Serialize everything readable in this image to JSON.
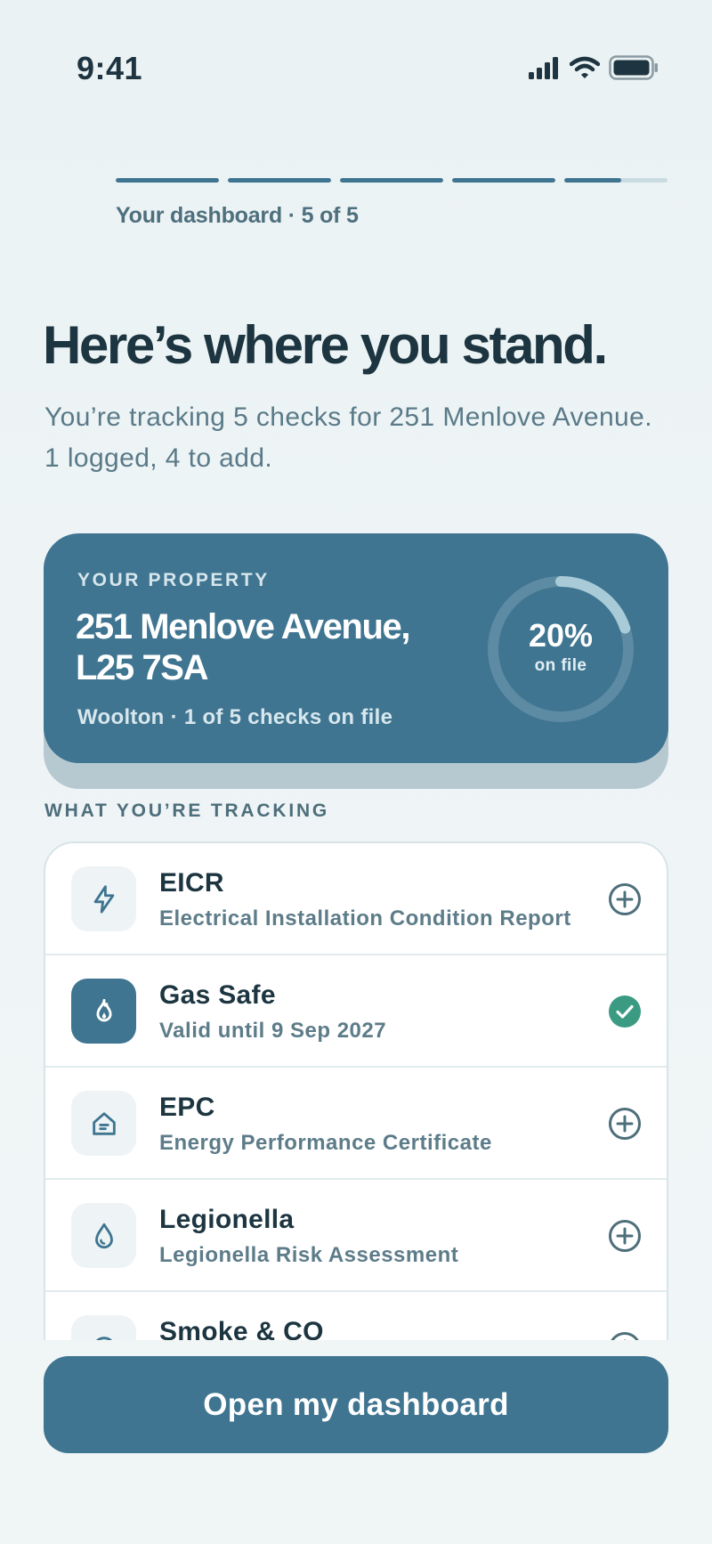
{
  "status_bar": {
    "time": "9:41",
    "icons": [
      "cellular-signal-icon",
      "wifi-icon",
      "battery-icon"
    ]
  },
  "progress": {
    "label": "Your dashboard · 5 of 5",
    "current_step": 5,
    "total_steps": 5,
    "last_segment_fill": 0.55
  },
  "header": {
    "title": "Here’s where you stand.",
    "subtitle": "You’re tracking 5 checks for 251 Menlove Avenue. 1 logged, 4 to add."
  },
  "property_card": {
    "eyebrow": "YOUR PROPERTY",
    "address": "251 Menlove Avenue, L25 7SA",
    "meta": "Woolton · 1 of 5 checks on file",
    "progress_percent": 20,
    "progress_label": "20%",
    "progress_sub": "on file"
  },
  "tracking": {
    "section_label": "WHAT YOU’RE TRACKING",
    "items": [
      {
        "title": "EICR",
        "subtitle": "Electrical Installation Condition Report",
        "icon": "lightning-bolt-icon",
        "status": "add"
      },
      {
        "title": "Gas Safe",
        "subtitle": "Valid until 9 Sep 2027",
        "icon": "flame-icon",
        "status": "done"
      },
      {
        "title": "EPC",
        "subtitle": "Energy Performance Certificate",
        "icon": "house-energy-icon",
        "status": "add"
      },
      {
        "title": "Legionella",
        "subtitle": "Legionella Risk Assessment",
        "icon": "water-drop-icon",
        "status": "add"
      },
      {
        "title": "Smoke & CO",
        "subtitle": "",
        "icon": "smoke-alarm-icon",
        "status": "add"
      }
    ]
  },
  "cta": {
    "label": "Open my dashboard"
  },
  "colors": {
    "primary": "#3f7591",
    "text_dark": "#1c3540",
    "text_muted": "#5d7c89",
    "success": "#3a9b82",
    "background": "#eef4f6"
  }
}
